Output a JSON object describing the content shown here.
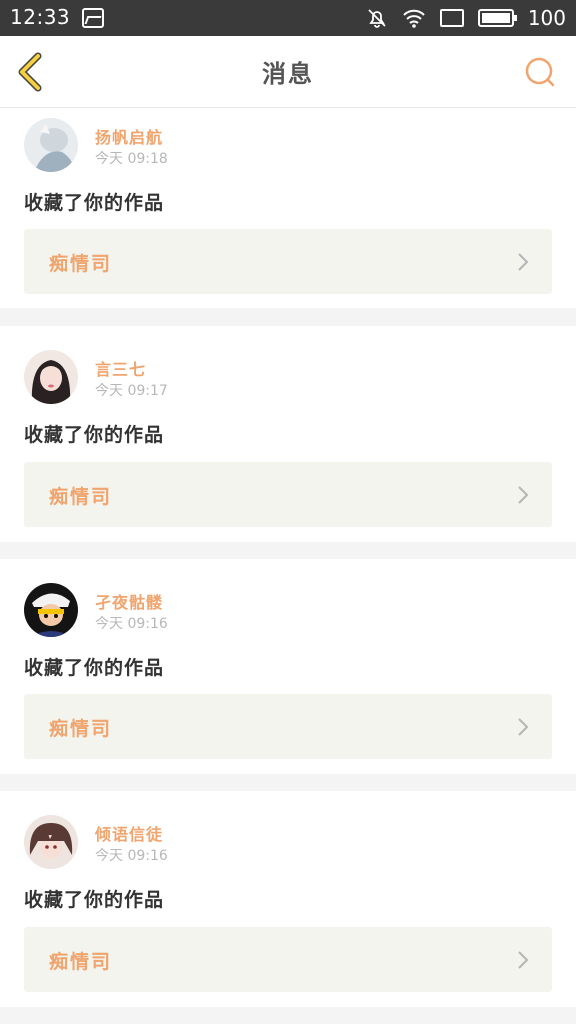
{
  "statusbar": {
    "time": "12:33",
    "battery": "100"
  },
  "header": {
    "title": "消息"
  },
  "colors": {
    "accent": "#f0a46e",
    "back_arrow": "#f4d03f",
    "work_bg": "#f4f4ee"
  },
  "messages": [
    {
      "user": "扬帆启航",
      "time": "今天 09:18",
      "action": "收藏了你的作品",
      "work": "痴情司"
    },
    {
      "user": "言三七",
      "time": "今天 09:17",
      "action": "收藏了你的作品",
      "work": "痴情司"
    },
    {
      "user": "孑夜骷髅",
      "time": "今天 09:16",
      "action": "收藏了你的作品",
      "work": "痴情司"
    },
    {
      "user": "倾语信徒",
      "time": "今天 09:16",
      "action": "收藏了你的作品",
      "work": "痴情司"
    }
  ]
}
